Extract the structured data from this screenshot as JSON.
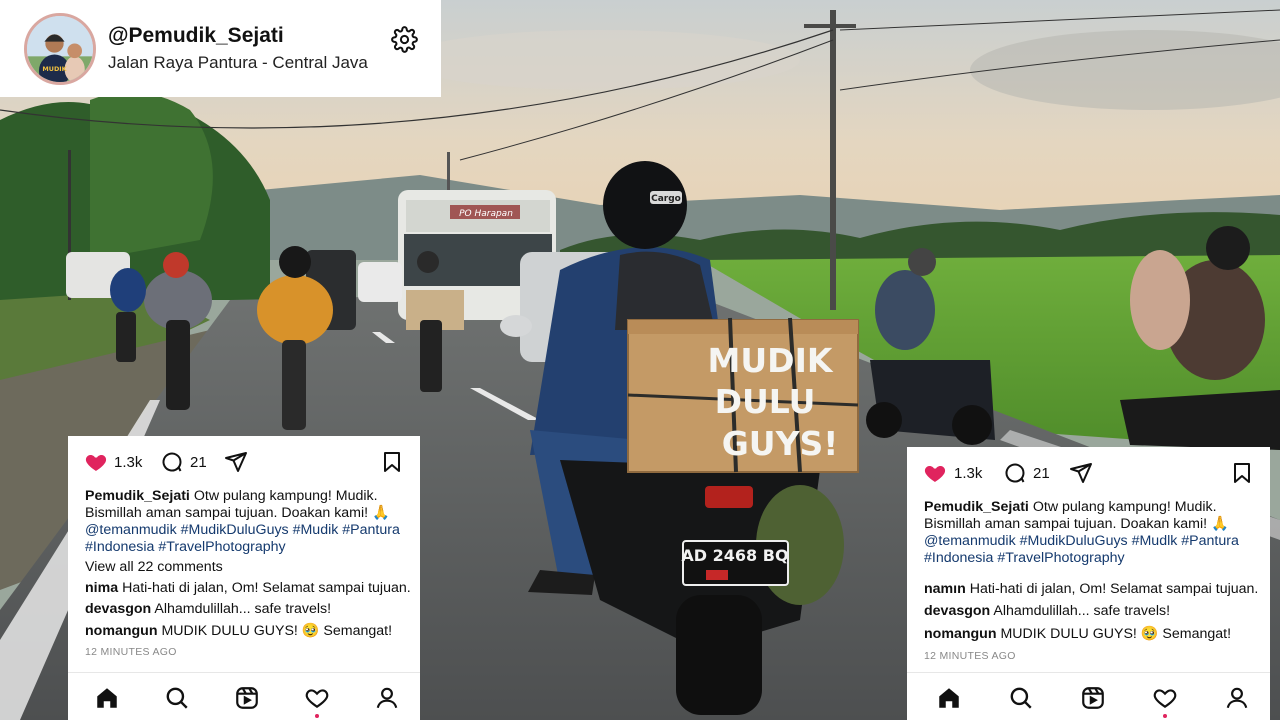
{
  "profile": {
    "username": "@Pemudik_Sejati",
    "location": "Jalan Raya Pantura - Central Java"
  },
  "scene": {
    "box_sign_lines": [
      "MUDIK",
      "DULU",
      "GUYS!"
    ],
    "bus_banner": "PO Harapan",
    "license_plate": "AD 2468 BQ",
    "helmet_brand": "Cargo"
  },
  "posts": [
    {
      "likes": "1.3k",
      "comments_count": "21",
      "caption_user": "Pemudik_Sejati",
      "caption_text": "Otw pulang kampung! Mudik. Bismillah aman sampai tujuan. Doakan kami! 🙏",
      "caption_tags": "@temanmudik #MudikDuluGuys #Mudik #Pantura #Indonesia #TravelPhotography",
      "view_all": "View all 22 comments",
      "comments": [
        {
          "user": "nima",
          "text": "Hati-hati di jalan, Om! Selamat sampai tujuan."
        },
        {
          "user": "devasgon",
          "text": "Alhamdulillah... safe travels!"
        },
        {
          "user": "nomangun",
          "text": "MUDIK DULU GUYS! 🥹 Semangat!"
        }
      ],
      "timestamp": "12 MINUTES AGO"
    },
    {
      "likes": "1.3k",
      "comments_count": "21",
      "caption_user": "Pemudik_Sejati",
      "caption_text": "Otw pulang kampung! Mudik. Bismillah aman sampai tujuan. Doakan kami! 🙏",
      "caption_tags": "@temanmudik #MudikDuluGuys #Mudlk #Pantura #Indonesia #TravelPhotography",
      "comments": [
        {
          "user": "namın",
          "text": "Hati-hati di jalan, Om! Selamat sampai tujuan."
        },
        {
          "user": "devasgon",
          "text": "Alhamdulillah... safe travels!"
        },
        {
          "user": "nomangun",
          "text": "MUDIK DULU GUYS! 🥹 Semangat!"
        }
      ],
      "timestamp": "12 MINUTES AGO"
    }
  ],
  "nav_items": [
    "home-icon",
    "search-icon",
    "reels-icon",
    "activity-heart-icon",
    "profile-icon"
  ],
  "colors": {
    "like_red": "#e0245e",
    "tag_blue": "#153a6e",
    "muted": "#8a8a8a"
  }
}
